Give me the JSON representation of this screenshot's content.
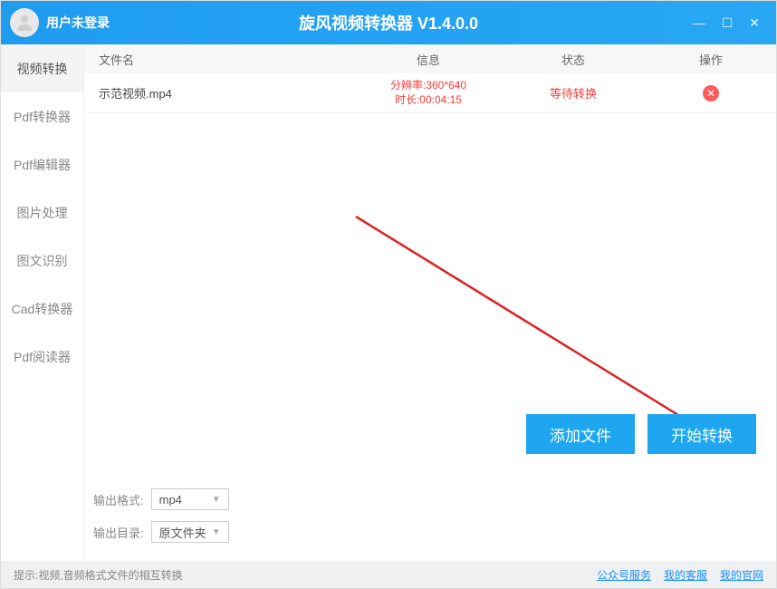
{
  "titlebar": {
    "user_status": "用户未登录",
    "app_title": "旋风视频转换器 V1.4.0.0"
  },
  "sidebar": {
    "items": [
      {
        "label": "视频转换",
        "active": true
      },
      {
        "label": "Pdf转换器",
        "active": false
      },
      {
        "label": "Pdf编辑器",
        "active": false
      },
      {
        "label": "图片处理",
        "active": false
      },
      {
        "label": "图文识别",
        "active": false
      },
      {
        "label": "Cad转换器",
        "active": false
      },
      {
        "label": "Pdf阅读器",
        "active": false
      }
    ]
  },
  "table": {
    "headers": {
      "name": "文件名",
      "info": "信息",
      "status": "状态",
      "action": "操作"
    },
    "rows": [
      {
        "name": "示范视频.mp4",
        "info_line1": "分辨率:360*640",
        "info_line2": "时长:00:04:15",
        "status": "等待转换"
      }
    ]
  },
  "buttons": {
    "add_file": "添加文件",
    "start_convert": "开始转换"
  },
  "output": {
    "format_label": "输出格式:",
    "format_value": "mp4",
    "dir_label": "输出目录:",
    "dir_value": "原文件夹"
  },
  "footer": {
    "tip": "提示:视频,音频格式文件的相互转换",
    "links": {
      "service": "公众号服务",
      "support": "我的客服",
      "site": "我的官网"
    }
  }
}
